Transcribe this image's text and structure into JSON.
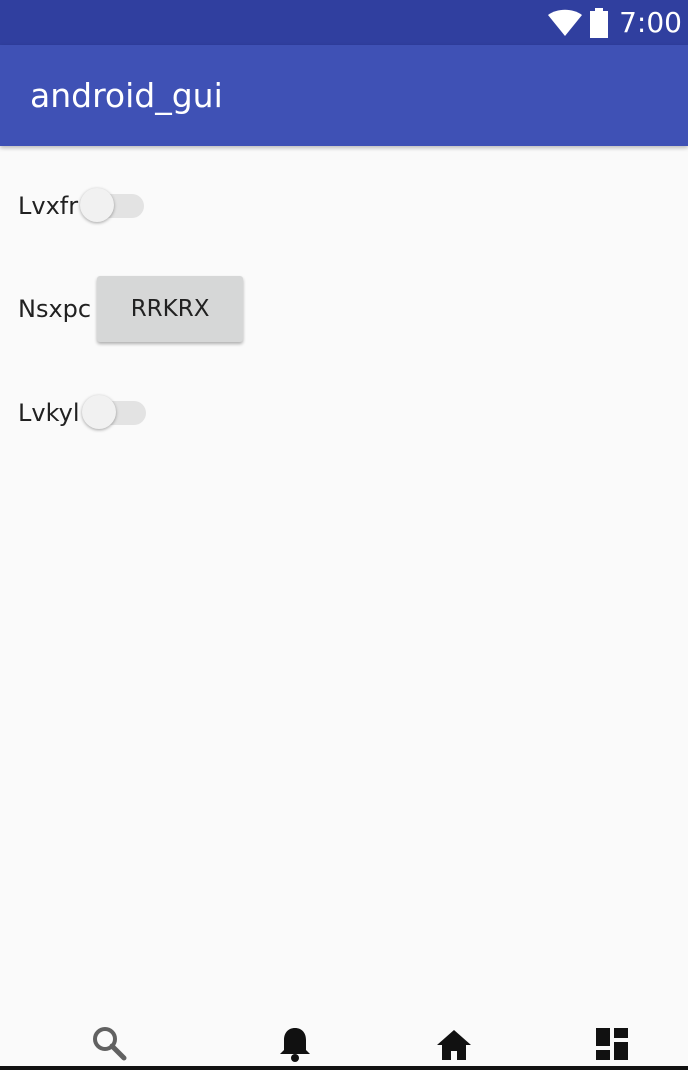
{
  "status_bar": {
    "time": "7:00",
    "icons": [
      "wifi-icon",
      "battery-icon"
    ]
  },
  "app_bar": {
    "title": "android_gui"
  },
  "rows": [
    {
      "label": "Lvxfr",
      "control": "switch",
      "checked": false
    },
    {
      "label": "Nsxpc",
      "control": "button",
      "button_label": "RRKRX"
    },
    {
      "label": "Lvkyl",
      "control": "switch",
      "checked": false
    }
  ],
  "bottom_nav": {
    "items": [
      "search-icon",
      "notification-bell-icon",
      "home-icon",
      "dashboard-icon"
    ]
  },
  "colors": {
    "primary": "#3f51b5",
    "primary_dark": "#303f9f",
    "background": "#fafafa"
  }
}
